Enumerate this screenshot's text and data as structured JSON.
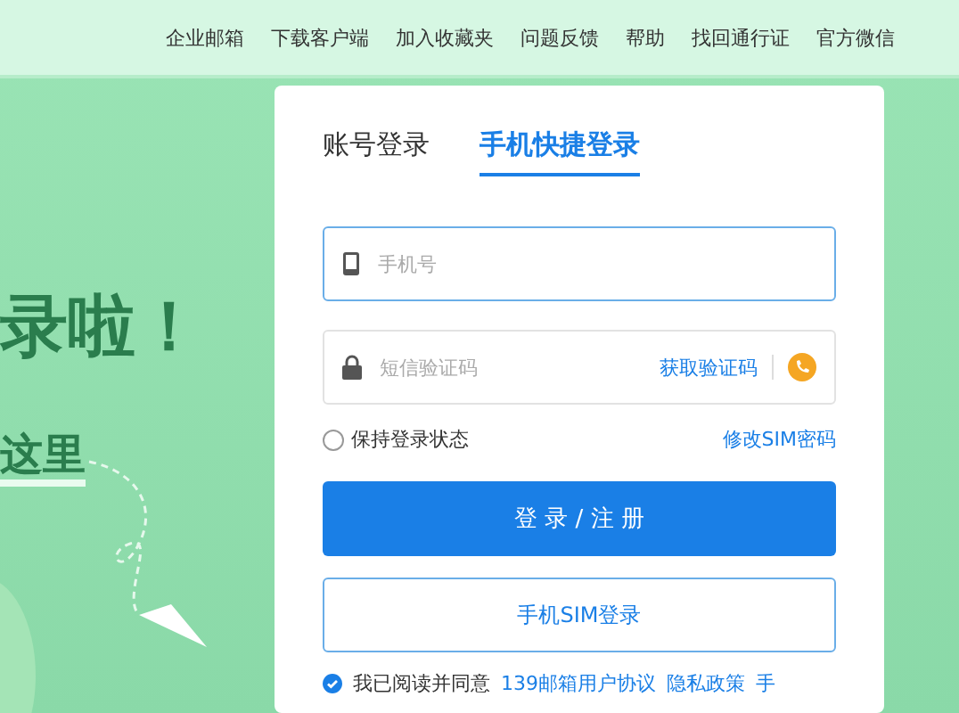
{
  "top_nav": [
    "企业邮箱",
    "下载客户端",
    "加入收藏夹",
    "问题反馈",
    "帮助",
    "找回通行证",
    "官方微信"
  ],
  "hero": {
    "headline": "录啦！",
    "subline": "这里"
  },
  "login": {
    "tabs": [
      {
        "label": "账号登录",
        "selected": false
      },
      {
        "label": "手机快捷登录",
        "selected": true
      }
    ],
    "phone_field": {
      "placeholder": "手机号"
    },
    "code_field": {
      "placeholder": "短信验证码",
      "action": "获取验证码"
    },
    "remember": {
      "label": "保持登录状态",
      "checked": false
    },
    "change_sim_link": "修改SIM密码",
    "primary_button": "登 录 / 注 册",
    "secondary_button": "手机SIM登录",
    "agreement": {
      "checked": true,
      "text": "我已阅读并同意",
      "links": [
        "139邮箱用户协议",
        "隐私政策",
        "手"
      ]
    }
  }
}
